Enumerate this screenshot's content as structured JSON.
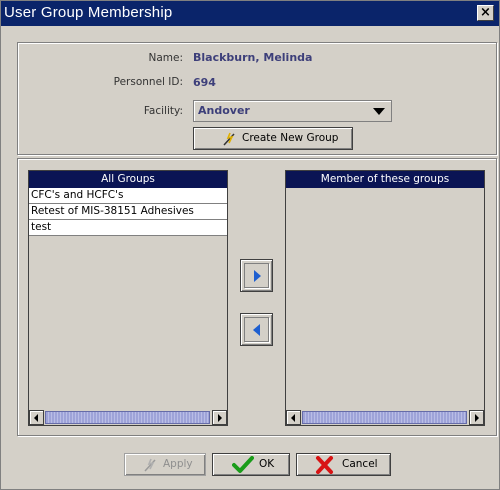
{
  "window": {
    "title": "User Group Membership",
    "close_label": "×"
  },
  "details": {
    "name_label": "Name:",
    "name_value": "Blackburn, Melinda",
    "personnel_label": "Personnel ID:",
    "personnel_value": "694",
    "facility_label": "Facility:",
    "facility_value": "Andover",
    "create_group_label": "Create New Group"
  },
  "all_groups": {
    "header": "All Groups",
    "items": [
      "CFC's and HCFC's",
      "Retest of MIS-38151 Adhesives",
      "test"
    ]
  },
  "member_groups": {
    "header": "Member of these groups",
    "items": []
  },
  "actions": {
    "apply_label": "Apply",
    "ok_label": "OK",
    "cancel_label": "Cancel"
  },
  "colors": {
    "title_bar": "#0a246a",
    "value_text": "#3d3f7a",
    "ok_check": "#1a9c1a",
    "cancel_x": "#d81414",
    "move_arrows": "#1e5fd0"
  }
}
